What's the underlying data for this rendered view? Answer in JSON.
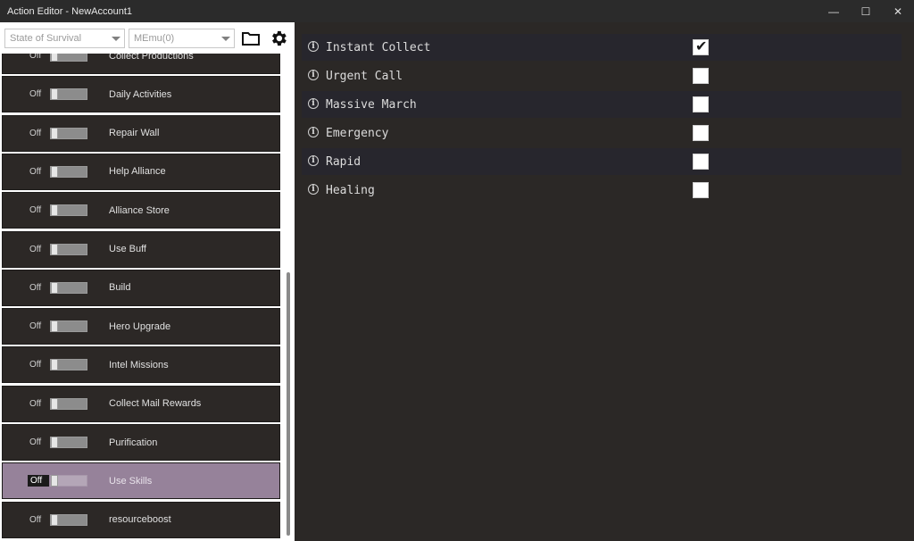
{
  "window": {
    "title": "Action Editor - NewAccount1",
    "controls": {
      "minimize": "—",
      "maximize": "☐",
      "close": "✕"
    }
  },
  "toolbar": {
    "game_select": "State of Survival",
    "emulator_select": "MEmu(0)"
  },
  "actions": [
    {
      "state": "Off",
      "label": "Collect Productions"
    },
    {
      "state": "Off",
      "label": "Daily Activities"
    },
    {
      "state": "Off",
      "label": "Repair Wall"
    },
    {
      "state": "Off",
      "label": "Help Alliance"
    },
    {
      "state": "Off",
      "label": "Alliance Store"
    },
    {
      "state": "Off",
      "label": "Use Buff"
    },
    {
      "state": "Off",
      "label": "Build"
    },
    {
      "state": "Off",
      "label": "Hero Upgrade"
    },
    {
      "state": "Off",
      "label": "Intel Missions"
    },
    {
      "state": "Off",
      "label": "Collect Mail Rewards"
    },
    {
      "state": "Off",
      "label": "Purification"
    },
    {
      "state": "Off",
      "label": "Use Skills",
      "selected": true
    },
    {
      "state": "Off",
      "label": "resourceboost"
    }
  ],
  "options": [
    {
      "label": "Instant Collect",
      "checked": true
    },
    {
      "label": "Urgent Call",
      "checked": false
    },
    {
      "label": "Massive March",
      "checked": false
    },
    {
      "label": "Emergency",
      "checked": false
    },
    {
      "label": "Rapid",
      "checked": false
    },
    {
      "label": "Healing",
      "checked": false
    }
  ],
  "icons": {
    "folder": "folder-icon",
    "settings": "gear-icon",
    "info": "info-icon",
    "checkmark": "✔"
  },
  "colors": {
    "selected_item": "#96829a",
    "panel_background": "#2b2826"
  }
}
